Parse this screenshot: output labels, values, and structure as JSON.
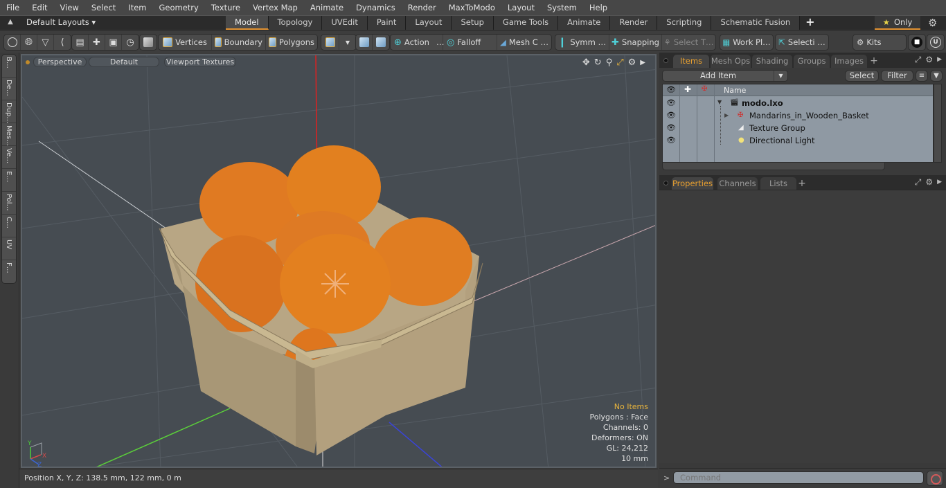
{
  "menu": [
    "File",
    "Edit",
    "View",
    "Select",
    "Item",
    "Geometry",
    "Texture",
    "Vertex Map",
    "Animate",
    "Dynamics",
    "Render",
    "MaxToModo",
    "Layout",
    "System",
    "Help"
  ],
  "layoutbar": {
    "layouts_label": "Default Layouts ▾",
    "tabs": [
      "Model",
      "Topology",
      "UVEdit",
      "Paint",
      "Layout",
      "Setup",
      "Game Tools",
      "Animate",
      "Render",
      "Scripting",
      "Schematic Fusion"
    ],
    "active_tab": "Model",
    "add_tab": "+",
    "only_label": "Only",
    "star": "★",
    "gear": "⚙"
  },
  "toolbar": {
    "vertices": "Vertices",
    "boundary": "Boundary",
    "polygons": "Polygons",
    "action": "Action",
    "action_more": "…",
    "falloff": "Falloff",
    "mesh_c": "Mesh C …",
    "symm": "Symm …",
    "snapping": "Snapping",
    "select_t": "Select T…",
    "work_pl": "Work Pl…",
    "selecti": "Selecti …",
    "kits": "Kits"
  },
  "left_tabs": [
    "B…",
    "De…",
    "Dup…",
    "Mes…",
    "Ve…",
    "E…",
    "Pol…",
    "C…",
    "UV",
    "F…"
  ],
  "viewport": {
    "view_mode": "Perspective",
    "shading": "Default",
    "textures": "Viewport Textures",
    "info": {
      "items": "No Items",
      "polygons": "Polygons : Face",
      "channels": "Channels: 0",
      "deformers": "Deformers: ON",
      "gl": "GL: 24,212",
      "scale": "10 mm"
    },
    "axis_labels": {
      "x": "X",
      "y": "Y",
      "z": "Z"
    }
  },
  "status": {
    "position": "Position X, Y, Z:   138.5 mm, 122 mm, 0 m"
  },
  "items_panel": {
    "tabs": [
      "Items",
      "Mesh Ops",
      "Shading",
      "Groups",
      "Images"
    ],
    "active_tab": "Items",
    "add_item": "Add Item",
    "select": "Select",
    "filter": "Filter",
    "name_header": "Name",
    "tree": [
      {
        "name": "modo.lxo",
        "bold": true,
        "icon": "scene"
      },
      {
        "name": "Mandarins_in_Wooden_Basket",
        "bold": false,
        "icon": "mesh"
      },
      {
        "name": "Texture Group",
        "bold": false,
        "icon": "texture-group"
      },
      {
        "name": "Directional Light",
        "bold": false,
        "icon": "light"
      }
    ]
  },
  "properties_panel": {
    "tabs": [
      "Properties",
      "Channels",
      "Lists"
    ],
    "active_tab": "Properties"
  },
  "command": {
    "prompt": ">",
    "placeholder": "Command"
  },
  "colors": {
    "accent": "#e2912f",
    "active_tab_text": "#e8a030",
    "info_highlight": "#e8b43c",
    "viewport_bg": "#464c52"
  }
}
